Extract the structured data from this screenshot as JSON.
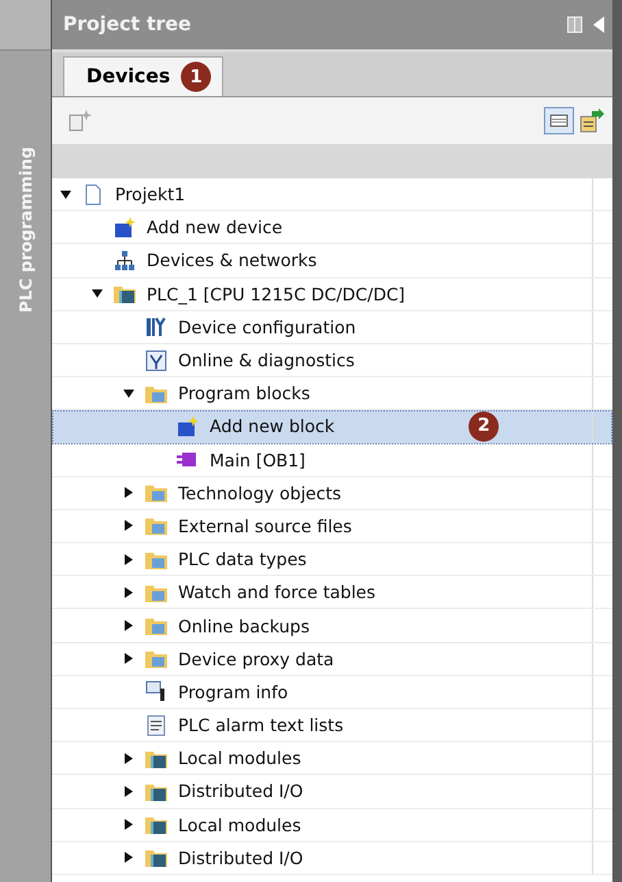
{
  "side_strip": {
    "label": "PLC programming"
  },
  "panel": {
    "title": "Project tree"
  },
  "tabs": [
    {
      "label": "Devices",
      "selected": true,
      "badge": "1"
    }
  ],
  "tree": [
    {
      "label": "Projekt1",
      "kind": "project",
      "expanded": true,
      "selected": false,
      "children": [
        {
          "label": "Add new device",
          "kind": "add-device",
          "selected": false
        },
        {
          "label": "Devices & networks",
          "kind": "network",
          "selected": false
        },
        {
          "label": "PLC_1 [CPU 1215C DC/DC/DC]",
          "kind": "plc",
          "expanded": true,
          "selected": false,
          "children": [
            {
              "label": "Device configuration",
              "kind": "device-config",
              "selected": false
            },
            {
              "label": "Online & diagnostics",
              "kind": "diagnostics",
              "selected": false
            },
            {
              "label": "Program blocks",
              "kind": "folder",
              "expanded": true,
              "selected": false,
              "children": [
                {
                  "label": "Add new block",
                  "kind": "add-block",
                  "selected": true,
                  "badge": "2"
                },
                {
                  "label": "Main [OB1]",
                  "kind": "block",
                  "selected": false
                }
              ]
            },
            {
              "label": "Technology objects",
              "kind": "folder",
              "expanded": false,
              "selected": false
            },
            {
              "label": "External source files",
              "kind": "folder",
              "expanded": false,
              "selected": false
            },
            {
              "label": "PLC data types",
              "kind": "folder",
              "expanded": false,
              "selected": false
            },
            {
              "label": "Watch and force tables",
              "kind": "folder",
              "expanded": false,
              "selected": false
            },
            {
              "label": "Online backups",
              "kind": "folder",
              "expanded": false,
              "selected": false
            },
            {
              "label": "Device proxy data",
              "kind": "folder",
              "expanded": false,
              "selected": false
            },
            {
              "label": "Program info",
              "kind": "info",
              "selected": false
            },
            {
              "label": "PLC alarm text lists",
              "kind": "list",
              "selected": false
            },
            {
              "label": "Local modules",
              "kind": "folder-module",
              "expanded": false,
              "selected": false
            },
            {
              "label": "Distributed I/O",
              "kind": "folder-module",
              "expanded": false,
              "selected": false
            },
            {
              "label": "Local modules",
              "kind": "folder-module",
              "expanded": false,
              "selected": false
            },
            {
              "label": "Distributed I/O",
              "kind": "folder-module",
              "expanded": false,
              "selected": false
            }
          ]
        }
      ]
    }
  ]
}
